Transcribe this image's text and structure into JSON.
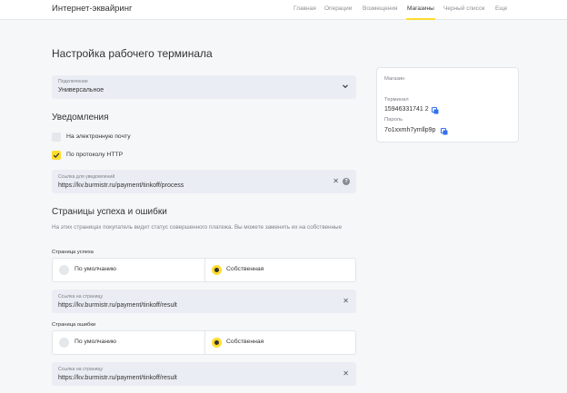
{
  "app": {
    "title": "Интернет-эквайринг"
  },
  "nav": {
    "items": [
      {
        "label": "Главная"
      },
      {
        "label": "Операции"
      },
      {
        "label": "Возмещения"
      },
      {
        "label": "Магазины"
      },
      {
        "label": "Черный список"
      },
      {
        "label": "Еще"
      }
    ],
    "active": "Магазины"
  },
  "page": {
    "title": "Настройка рабочего терминала"
  },
  "connection": {
    "label": "Подключение",
    "value": "Универсальное",
    "icon": "chevron-down-icon"
  },
  "notifications": {
    "title": "Уведомления",
    "email": {
      "label": "На электронную почту",
      "checked": false
    },
    "http": {
      "label": "По протоколу HTTP",
      "checked": true
    },
    "url": {
      "label": "Ссылка для уведомлений",
      "value": "https://kv.burmistr.ru/payment/tinkoff/process",
      "help": "?"
    }
  },
  "pages": {
    "title": "Страницы успеха и ошибки",
    "description": "На этих страницах покупатель видит статус совершенного платежа. Вы можете заменить их на собственные",
    "success": {
      "group_label": "Страница успеха",
      "option_default": "По умолчанию",
      "option_custom": "Собственная",
      "selected": "custom",
      "url_label": "Ссылка на страницу",
      "url_value": "https://kv.burmistr.ru/payment/tinkoff/result"
    },
    "error": {
      "group_label": "Страница ошибки",
      "option_default": "По умолчанию",
      "option_custom": "Собственная",
      "selected": "custom",
      "url_label": "Ссылка на страницу",
      "url_value": "https://kv.burmistr.ru/payment/tinkoff/result"
    }
  },
  "shop_card": {
    "title": "Магазин",
    "terminal_label": "Терминал",
    "terminal_value": "15946331741 2",
    "password_label": "Пароль",
    "password_value": "7o1xxmh7ymllp9p"
  },
  "colors": {
    "accent": "#ffdd2d",
    "field_bg": "#eaedf3",
    "copy": "#336fee"
  }
}
